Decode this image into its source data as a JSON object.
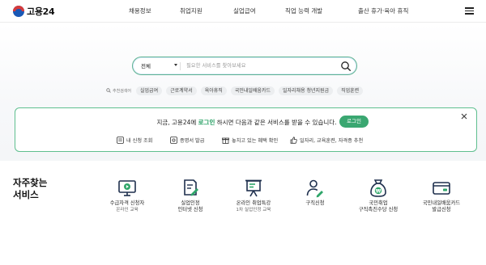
{
  "header": {
    "logo_text": "고용24",
    "nav": [
      "채용정보",
      "취업지원",
      "실업급여",
      "직업 능력 개발",
      "출산 휴가·육아 휴직"
    ]
  },
  "search": {
    "scope": "전체",
    "placeholder": "필요한 서비스를 찾아보세요"
  },
  "recommended": {
    "label": "추천검색어",
    "chips": [
      "실업급여",
      "근로계약서",
      "육아휴직",
      "국민내일배움카드",
      "일자리채용 청년지원금",
      "직업훈련"
    ]
  },
  "login_banner": {
    "msg_prefix": "지금, 고용24에",
    "msg_login": "로그인",
    "msg_suffix": "하시면 다음과 같은 서비스를 받을 수 있습니다.",
    "button": "로그인",
    "quick_items": [
      "내 신청 조회",
      "증명서 발급",
      "놓치고 있는 혜택 확인",
      "일자리, 교육훈련, 자격증 추천"
    ]
  },
  "frequent": {
    "title_line1": "자주찾는",
    "title_line2": "서비스",
    "items": [
      {
        "line1": "수급자격 신청자",
        "line2": "온라인 교육",
        "icon": "monitor-play-icon"
      },
      {
        "line1": "실업인정",
        "line2": "인터넷 신청",
        "icon": "document-pen-icon"
      },
      {
        "line1": "온라인 취업특강",
        "line2": "1차 실업인정 교육",
        "icon": "presentation-board-icon"
      },
      {
        "line1": "구직신청",
        "line2": "",
        "icon": "person-pen-icon"
      },
      {
        "line1": "국민취업",
        "line2": "구직촉진수당 신청",
        "icon": "money-bag-icon"
      },
      {
        "line1": "국민내일배움카드",
        "line2": "발급신청",
        "icon": "card-icon"
      }
    ]
  },
  "colors": {
    "accent_green": "#3aa771",
    "border_green": "#5fbf8f",
    "icon_navy": "#1e2f4d",
    "icon_green": "#2fa66a"
  }
}
